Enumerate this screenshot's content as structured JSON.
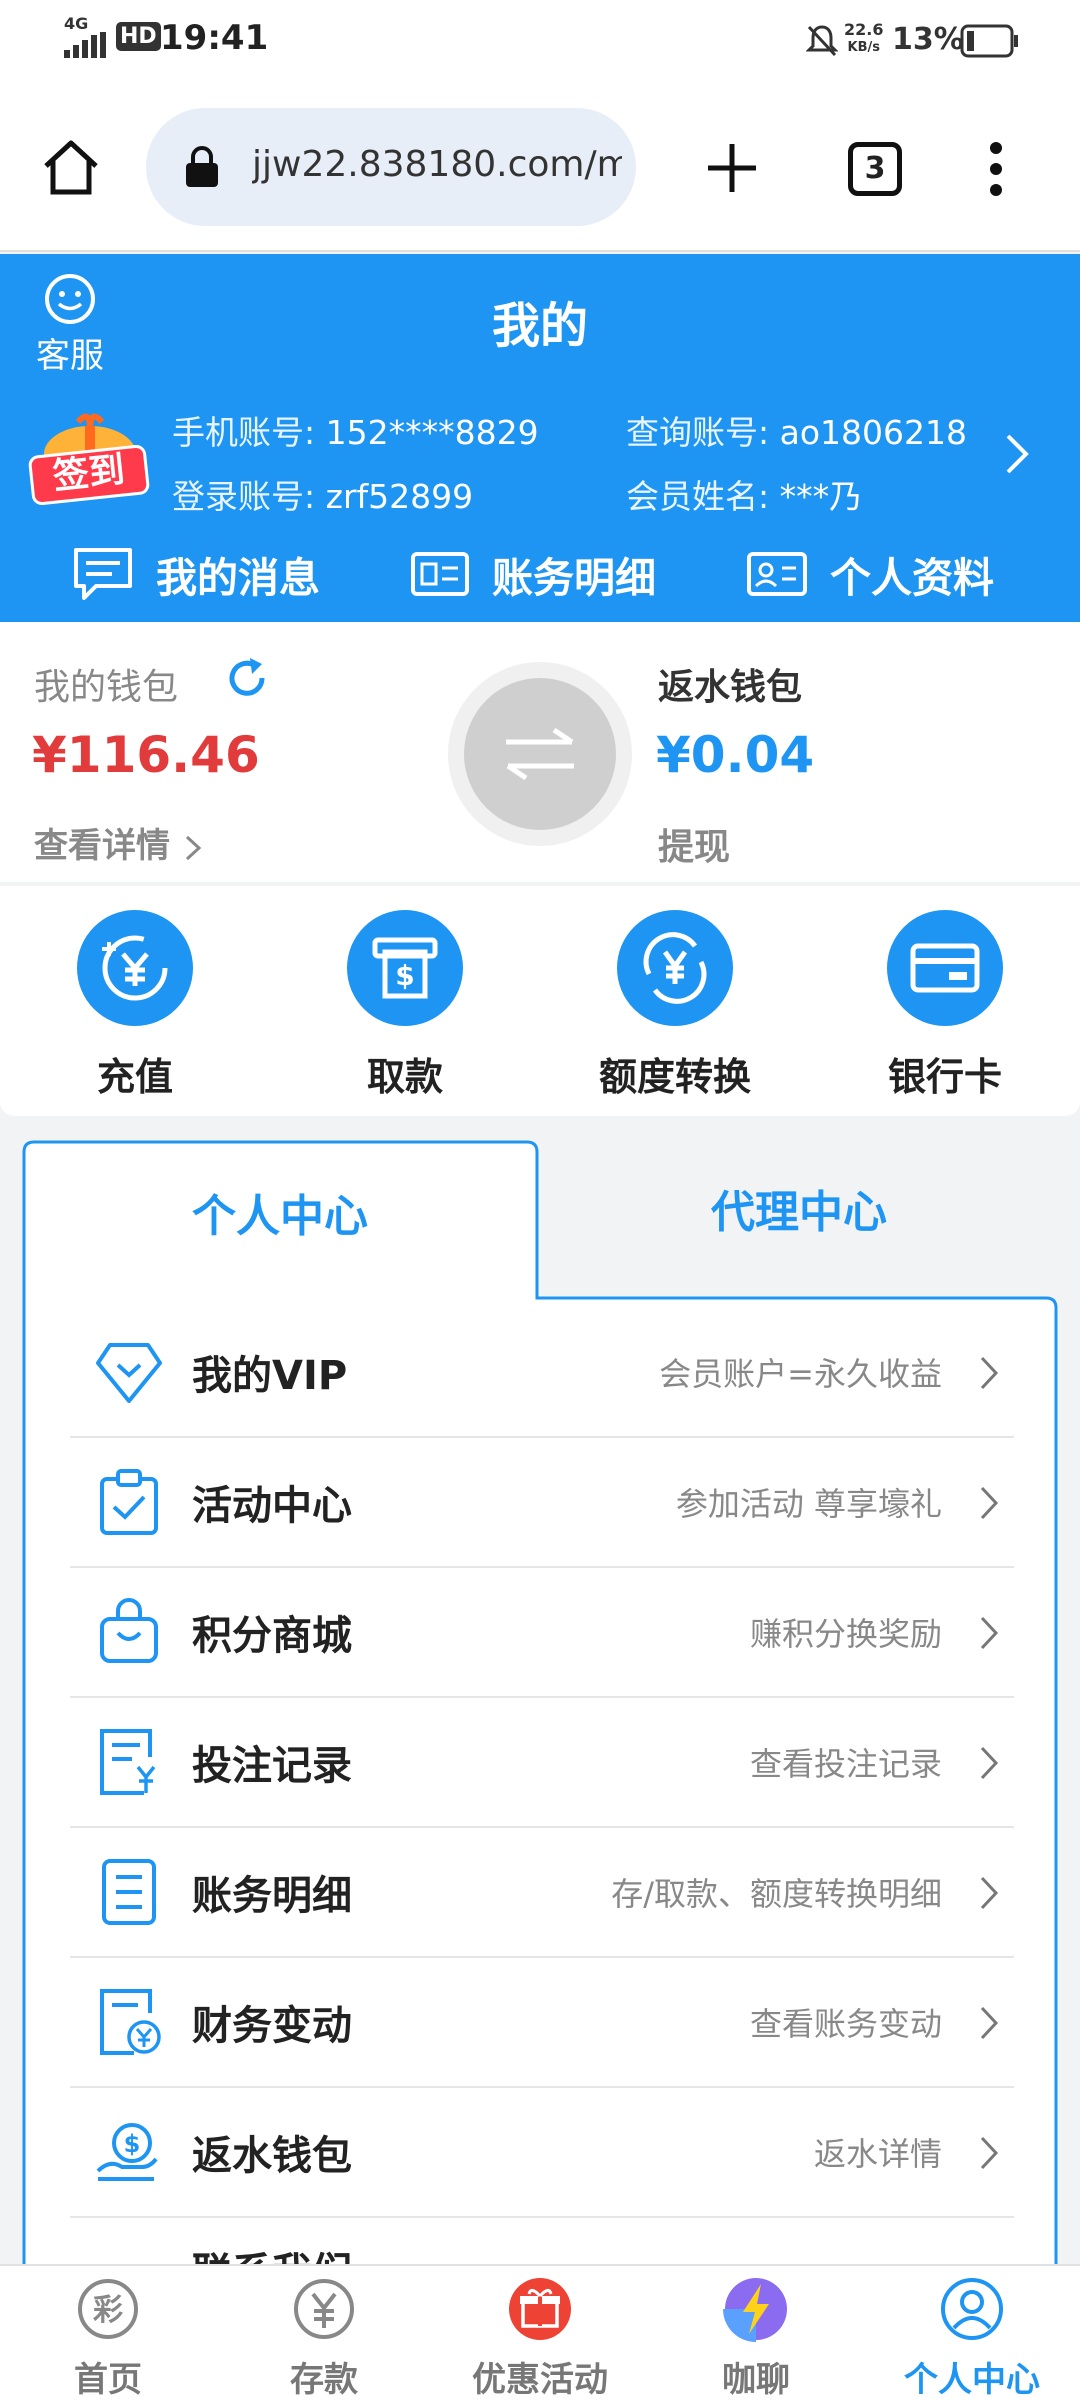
{
  "status_bar": {
    "network": "4G",
    "hd": "HD",
    "time": "19:41",
    "speed_value": "22.6",
    "speed_unit": "KB/s",
    "battery": "13%"
  },
  "browser": {
    "url": "jjw22.838180.com/m",
    "tab_count": "3"
  },
  "header": {
    "title": "我的",
    "service_label": "客服",
    "checkin_label": "签到",
    "phone_label": "手机账号:",
    "phone_value": "152****8829",
    "query_label": "查询账号:",
    "query_value": "ao1806218",
    "login_label": "登录账号:",
    "login_value": "zrf52899",
    "name_label": "会员姓名:",
    "name_value": "***乃",
    "menu": [
      "我的消息",
      "账务明细",
      "个人资料"
    ]
  },
  "wallet": {
    "main_label": "我的钱包",
    "main_amount": "¥116.46",
    "details_link": "查看详情",
    "rebate_label": "返水钱包",
    "rebate_amount": "¥0.04",
    "withdraw_link": "提现"
  },
  "actions": [
    "充值",
    "取款",
    "额度转换",
    "银行卡"
  ],
  "tabs": {
    "personal": "个人中心",
    "agent": "代理中心"
  },
  "list": [
    {
      "title": "我的VIP",
      "desc": "会员账户=永久收益"
    },
    {
      "title": "活动中心",
      "desc": "参加活动 尊享壕礼"
    },
    {
      "title": "积分商城",
      "desc": "赚积分换奖励"
    },
    {
      "title": "投注记录",
      "desc": "查看投注记录"
    },
    {
      "title": "账务明细",
      "desc": "存/取款、额度转换明细"
    },
    {
      "title": "财务变动",
      "desc": "查看账务变动"
    },
    {
      "title": "返水钱包",
      "desc": "返水详情"
    },
    {
      "title": "联系我们",
      "desc": ""
    }
  ],
  "bottom_nav": [
    "首页",
    "存款",
    "优惠活动",
    "咖聊",
    "个人中心"
  ],
  "colors": {
    "brand_blue": "#1e95f2",
    "amount_red": "#e23b3b",
    "amount_blue": "#1e95f2"
  },
  "icons": [
    "home-icon",
    "lock-icon",
    "plus-icon",
    "tabs-icon",
    "more-icon",
    "smiley-icon",
    "refresh-icon",
    "swap-icon",
    "chevron-right-icon"
  ]
}
